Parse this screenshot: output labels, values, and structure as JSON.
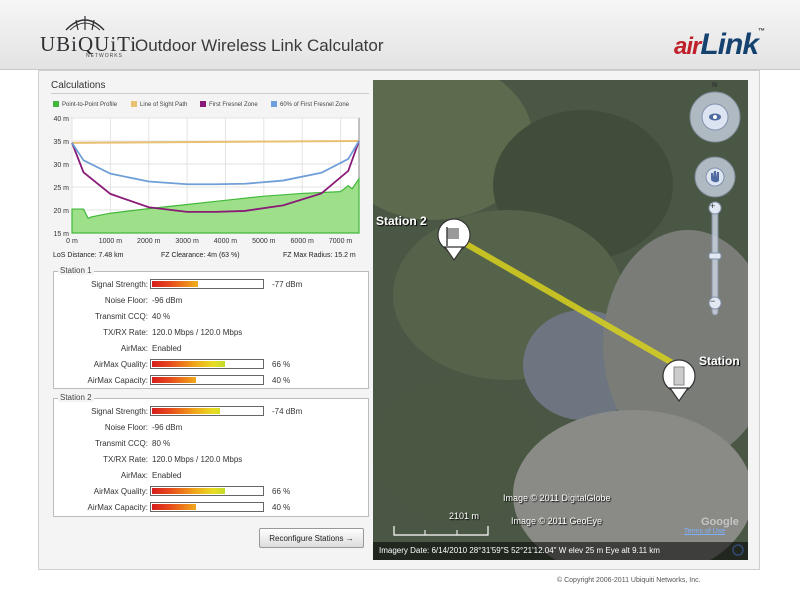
{
  "header": {
    "brand_logo_text": "UBiQUiTi",
    "brand_logo_subtext": "NETWORKS",
    "app_title": "Outdoor Wireless Link Calculator",
    "product_logo_prefix": "air",
    "product_logo_main": "Link",
    "product_logo_tm": "™"
  },
  "calculations": {
    "section_title": "Calculations",
    "legend": [
      {
        "label": "Point-to-Point Profile",
        "color": "#42b83a"
      },
      {
        "label": "Line of Sight Path",
        "color": "#e8c070"
      },
      {
        "label": "First Fresnel Zone",
        "color": "#8a1a78"
      },
      {
        "label": "60% of First Fresnel Zone",
        "color": "#6f9fd8"
      }
    ],
    "stats": {
      "los_distance": "LoS Distance: 7.48 km",
      "fz_clearance": "FZ Clearance: 4m (63 %)",
      "fz_max_radius": "FZ Max Radius: 15.2 m"
    }
  },
  "chart_data": {
    "type": "line",
    "x_tick_labels": [
      "0 m",
      "1000 m",
      "2000 m",
      "3000 m",
      "4000 m",
      "5000 m",
      "6000 m",
      "7000 m"
    ],
    "y_tick_labels": [
      "15 m",
      "20 m",
      "25 m",
      "30 m",
      "35 m",
      "40 m"
    ],
    "xlim": [
      0,
      7480
    ],
    "ylim": [
      15,
      40
    ],
    "grid": true,
    "series": [
      {
        "name": "Point-to-Point Profile",
        "type": "area",
        "color": "#42b83a",
        "x": [
          0,
          300,
          420,
          500,
          1000,
          2000,
          3000,
          4000,
          5000,
          6000,
          7000,
          7200,
          7300,
          7480
        ],
        "y": [
          20.2,
          20.2,
          18.2,
          18.5,
          19.3,
          20.3,
          21.2,
          22.1,
          23.0,
          23.6,
          24.0,
          25.3,
          24.6,
          26.8
        ]
      },
      {
        "name": "Line of Sight Path",
        "color": "#e8c070",
        "x": [
          0,
          7480
        ],
        "y": [
          34.6,
          35.0
        ]
      },
      {
        "name": "First Fresnel Zone",
        "color": "#8a1a78",
        "x": [
          0,
          300,
          1000,
          2000,
          3000,
          3740,
          4500,
          5500,
          6500,
          7200,
          7480
        ],
        "y": [
          34.6,
          28.2,
          23.5,
          20.6,
          19.6,
          19.6,
          19.8,
          21.0,
          23.6,
          28.5,
          35.0
        ]
      },
      {
        "name": "60% of First Fresnel Zone",
        "color": "#6f9fd8",
        "x": [
          0,
          300,
          1000,
          2000,
          3000,
          3740,
          4500,
          5500,
          6500,
          7200,
          7480
        ],
        "y": [
          34.6,
          30.8,
          27.9,
          26.2,
          25.6,
          25.6,
          25.7,
          26.4,
          28.1,
          31.1,
          35.0
        ]
      }
    ]
  },
  "station1": {
    "title": "Station 1",
    "rows": [
      {
        "label": "Signal Strength:",
        "value": "-77 dBm",
        "bar": 0.42
      },
      {
        "label": "Noise Floor:",
        "value": "-96 dBm"
      },
      {
        "label": "Transmit CCQ:",
        "value": "40 %"
      },
      {
        "label": "TX/RX Rate:",
        "value": "120.0 Mbps / 120.0 Mbps"
      },
      {
        "label": "AirMax:",
        "value": "Enabled"
      },
      {
        "label": "AirMax Quality:",
        "value": "66 %",
        "bar": 0.66
      },
      {
        "label": "AirMax Capacity:",
        "value": "40 %",
        "bar": 0.4
      }
    ]
  },
  "station2": {
    "title": "Station 2",
    "rows": [
      {
        "label": "Signal Strength:",
        "value": "-74 dBm",
        "bar": 0.62
      },
      {
        "label": "Noise Floor:",
        "value": "-96 dBm"
      },
      {
        "label": "Transmit CCQ:",
        "value": "80 %"
      },
      {
        "label": "TX/RX Rate:",
        "value": "120.0 Mbps / 120.0 Mbps"
      },
      {
        "label": "AirMax:",
        "value": "Enabled"
      },
      {
        "label": "AirMax Quality:",
        "value": "66 %",
        "bar": 0.66
      },
      {
        "label": "AirMax Capacity:",
        "value": "40 %",
        "bar": 0.4
      }
    ]
  },
  "reconfigure_button": "Reconfigure Stations →",
  "map": {
    "station_a_label": "Station 2",
    "station_b_label": "Station",
    "compass_label": "N",
    "scale_label": "2101 m",
    "imagery_credit_1": "Image © 2011 DigitalGlobe",
    "imagery_credit_2": "Image © 2011 GeoEye",
    "google_logo": "Google",
    "terms_link": "Terms of Use",
    "status_bar": "Imagery Date: 6/14/2010 28°31'59\"S 52°21'12.04\" W  elev  25 m  Eye alt  9.11 km",
    "zoom_plus": "+",
    "zoom_minus": "−"
  },
  "footer": {
    "copyright": "© Copyright 2006-2011 Ubiquiti Networks, Inc."
  }
}
